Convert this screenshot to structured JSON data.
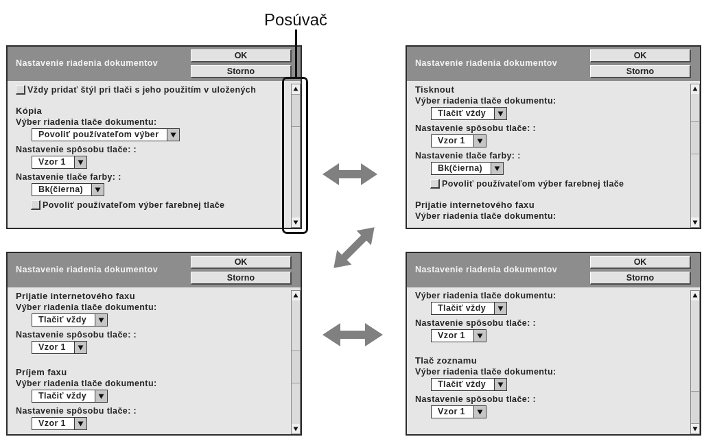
{
  "panels": [
    {
      "title": "Nastavenie riadenia dokumentov",
      "buttons": [
        "OK",
        "Storno"
      ],
      "scrollbar": {
        "highlighted": true,
        "callout": "Posúvač"
      },
      "sections": [
        {
          "items": [
            {
              "kind": "checkbox",
              "label": "Vždy pridať štýl pri tlači s jeho použitím v uložených",
              "checked": false
            }
          ]
        },
        {
          "heading": "Kópia",
          "items": [
            {
              "kind": "select",
              "label": "Výber riadenia tlače dokumentu:",
              "value": "Povoliť používateľom výber"
            },
            {
              "kind": "select",
              "label": "Nastavenie spôsobu tlače: :",
              "value": "Vzor 1"
            },
            {
              "kind": "select",
              "label": "Nastavenie tlače farby: :",
              "value": "Bk(čierna)"
            },
            {
              "kind": "checkbox",
              "label": "Povoliť používateľom výber farebnej tlače",
              "checked": false
            }
          ]
        }
      ]
    },
    {
      "title": "Nastavenie riadenia dokumentov",
      "buttons": [
        "OK",
        "Storno"
      ],
      "scrollbar": {
        "highlighted": false
      },
      "sections": [
        {
          "heading": "Tisknout",
          "items": [
            {
              "kind": "select",
              "label": "Výber riadenia tlače dokumentu:",
              "value": "Tlačiť vždy"
            },
            {
              "kind": "select",
              "label": "Nastavenie spôsobu tlače: :",
              "value": "Vzor 1"
            },
            {
              "kind": "select",
              "label": "Nastavenie tlače farby: :",
              "value": "Bk(čierna)"
            },
            {
              "kind": "checkbox",
              "label": "Povoliť používateľom výber farebnej tlače",
              "checked": false
            }
          ]
        },
        {
          "heading": "Prijatie internetového faxu",
          "items": [
            {
              "kind": "select",
              "label": "Výber riadenia tlače dokumentu:"
            }
          ]
        }
      ]
    },
    {
      "title": "Nastavenie riadenia dokumentov",
      "buttons": [
        "OK",
        "Storno"
      ],
      "scrollbar": {
        "highlighted": false
      },
      "sections": [
        {
          "heading": "Prijatie internetového faxu",
          "items": [
            {
              "kind": "select",
              "label": "Výber riadenia tlače dokumentu:",
              "value": "Tlačiť vždy"
            },
            {
              "kind": "select",
              "label": "Nastavenie spôsobu tlače: :",
              "value": "Vzor 1"
            }
          ]
        },
        {
          "heading": "Príjem faxu",
          "items": [
            {
              "kind": "select",
              "label": "Výber riadenia tlače dokumentu:",
              "value": "Tlačiť vždy"
            },
            {
              "kind": "select",
              "label": "Nastavenie spôsobu tlače: :",
              "value": "Vzor 1"
            }
          ]
        }
      ]
    },
    {
      "title": "Nastavenie riadenia dokumentov",
      "buttons": [
        "OK",
        "Storno"
      ],
      "scrollbar": {
        "highlighted": false
      },
      "sections": [
        {
          "items": [
            {
              "kind": "select",
              "label": "Výber riadenia tlače dokumentu:",
              "value": "Tlačiť vždy"
            },
            {
              "kind": "select",
              "label": "Nastavenie spôsobu tlače: :",
              "value": "Vzor 1"
            }
          ]
        },
        {
          "heading": "Tlač zoznamu",
          "items": [
            {
              "kind": "select",
              "label": "Výber riadenia tlače dokumentu:",
              "value": "Tlačiť vždy"
            },
            {
              "kind": "select",
              "label": "Nastavenie spôsobu tlače: :",
              "value": "Vzor 1"
            }
          ]
        }
      ]
    }
  ]
}
